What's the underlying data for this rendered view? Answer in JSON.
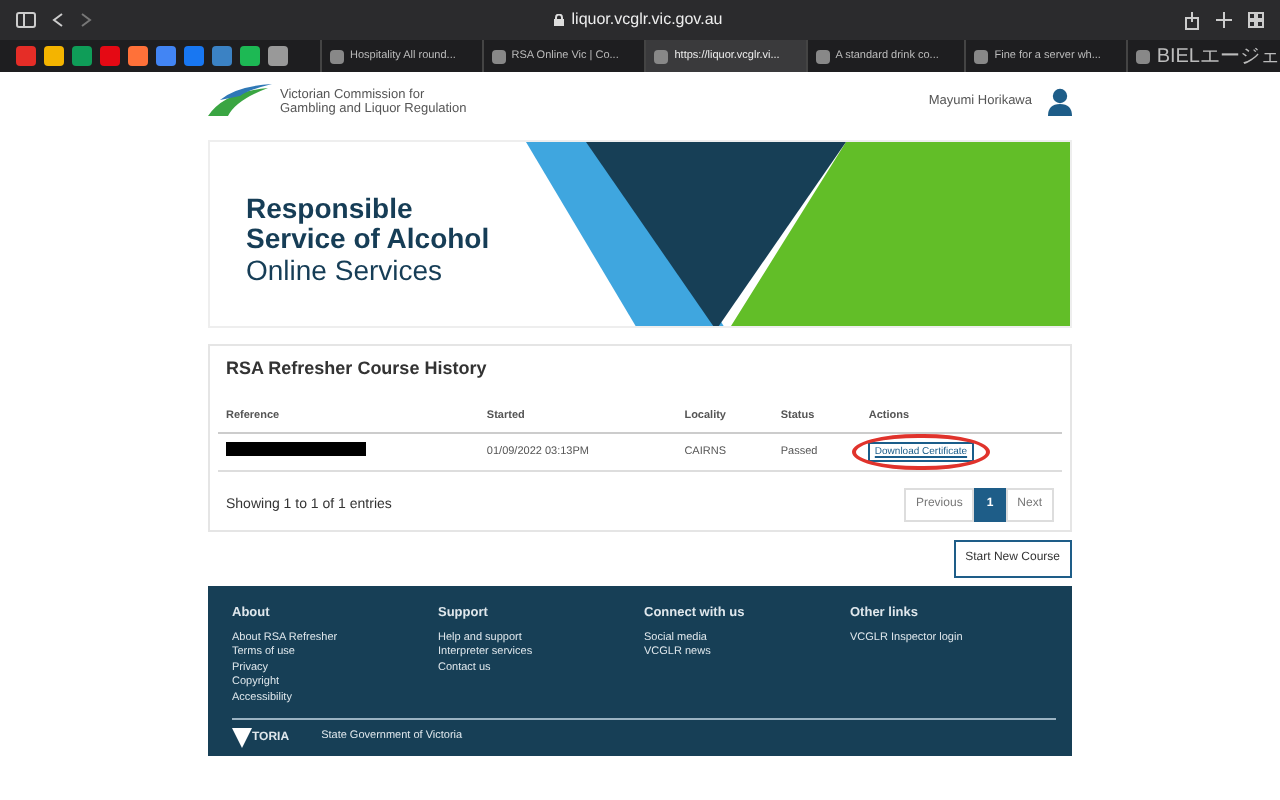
{
  "browser": {
    "address": "liquor.vcglr.vic.gov.au",
    "tabs": [
      {
        "label": "Hospitality All round...",
        "selected": false
      },
      {
        "label": "RSA Online Vic | Co...",
        "selected": false
      },
      {
        "label": "https://liquor.vcglr.vi...",
        "selected": true
      },
      {
        "label": "A standard drink co...",
        "selected": false
      },
      {
        "label": "Fine for a server wh...",
        "selected": false
      },
      {
        "label": "BIELエージェ",
        "selected": false
      }
    ]
  },
  "header": {
    "org_line1": "Victorian Commission for",
    "org_line2": "Gambling and Liquor Regulation",
    "user": "Mayumi Horikawa"
  },
  "banner": {
    "line1": "Responsible",
    "line2": "Service of Alcohol",
    "line3": "Online Services"
  },
  "history": {
    "title": "RSA Refresher Course History",
    "columns": [
      "Reference",
      "Started",
      "Locality",
      "Status",
      "Actions"
    ],
    "rows": [
      {
        "reference_redacted": true,
        "started": "01/09/2022 03:13PM",
        "locality": "CAIRNS",
        "status": "Passed",
        "action": "Download Certificate",
        "action_circled": true
      }
    ],
    "summary": "Showing 1 to 1 of 1 entries",
    "pagination": [
      {
        "label": "Previous",
        "selected": false
      },
      {
        "label": "1",
        "selected": true
      },
      {
        "label": "Next",
        "selected": false
      }
    ]
  },
  "start_button": "Start New Course",
  "footer": {
    "columns": [
      {
        "heading": "About",
        "links": [
          "About RSA Refresher",
          "Terms of use",
          "Privacy",
          "Copyright",
          "Accessibility"
        ]
      },
      {
        "heading": "Support",
        "links": [
          "Help and support",
          "Interpreter services",
          "Contact us"
        ]
      },
      {
        "heading": "Connect with us",
        "links": [
          "Social media",
          "VCGLR news"
        ]
      },
      {
        "heading": "Other links",
        "links": [
          "VCGLR Inspector login"
        ]
      }
    ],
    "logo_text": "TORIA",
    "government": "State Government of Victoria"
  }
}
